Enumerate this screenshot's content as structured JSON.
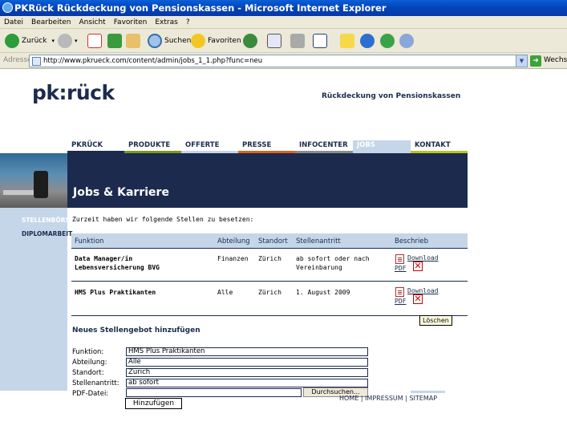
{
  "window": {
    "title": "PKRück Rückdeckung von Pensionskassen - Microsoft Internet Explorer"
  },
  "menu": [
    "Datei",
    "Bearbeiten",
    "Ansicht",
    "Favoriten",
    "Extras",
    "?"
  ],
  "toolbar": {
    "back": "Zurück",
    "search": "Suchen",
    "favorites": "Favoriten"
  },
  "address": {
    "label": "Adresse",
    "url": "http://www.pkrueck.com/content/admin/jobs_1_1.php?func=neu",
    "go": "Wechseln"
  },
  "site": {
    "logo": "pk:rück",
    "tagline": "Rückdeckung von Pensionskassen",
    "nav": [
      {
        "label": "PKRÜCK",
        "color": "#1c2b4d"
      },
      {
        "label": "PRODUKTE",
        "color": "#7a9a1e"
      },
      {
        "label": "OFFERTE",
        "color": "#c4d6e8"
      },
      {
        "label": "PRESSE",
        "color": "#d9641e"
      },
      {
        "label": "INFOCENTER",
        "color": "#8c8c8c"
      },
      {
        "label": "JOBS",
        "color": "#c4d6e8"
      },
      {
        "label": "KONTAKT",
        "color": "#b8c41e"
      }
    ],
    "banner_title": "Jobs & Karriere",
    "sidebar": [
      "STELLENBÖRSE",
      "DIPLOMARBEIT"
    ]
  },
  "jobs": {
    "intro": "Zurzeit haben wir folgende Stellen zu besetzen:",
    "headers": [
      "Funktion",
      "Abteilung",
      "Standort",
      "Stellenantritt",
      "Beschrieb"
    ],
    "rows": [
      {
        "funktion_1": "Data Manager/in",
        "funktion_2": "Lebensversicherung BVG",
        "abteilung": "Finanzen",
        "standort": "Zürich",
        "antritt_1": "ab sofort oder nach",
        "antritt_2": "Vereinbarung",
        "download_1": "Download",
        "download_2": "PDF"
      },
      {
        "funktion_1": "HMS Plus Praktikanten",
        "funktion_2": "",
        "abteilung": "Alle",
        "standort": "Zürich",
        "antritt_1": "1. August 2009",
        "antritt_2": "",
        "download_1": "Download",
        "download_2": "PDF"
      }
    ],
    "tooltip": "Löschen"
  },
  "form": {
    "title": "Neues Stellengebot hinzufügen",
    "labels": [
      "Funktion:",
      "Abteilung:",
      "Standort:",
      "Stellenantritt:",
      "PDF-Datei:"
    ],
    "values": [
      "HMS Plus Praktikanten",
      "Alle",
      "Zürich",
      "ab sofort",
      ""
    ],
    "browse": "Durchsuchen...",
    "submit": "Hinzufügen"
  },
  "footer": "HOME | IMPRESSUM | SITEMAP"
}
